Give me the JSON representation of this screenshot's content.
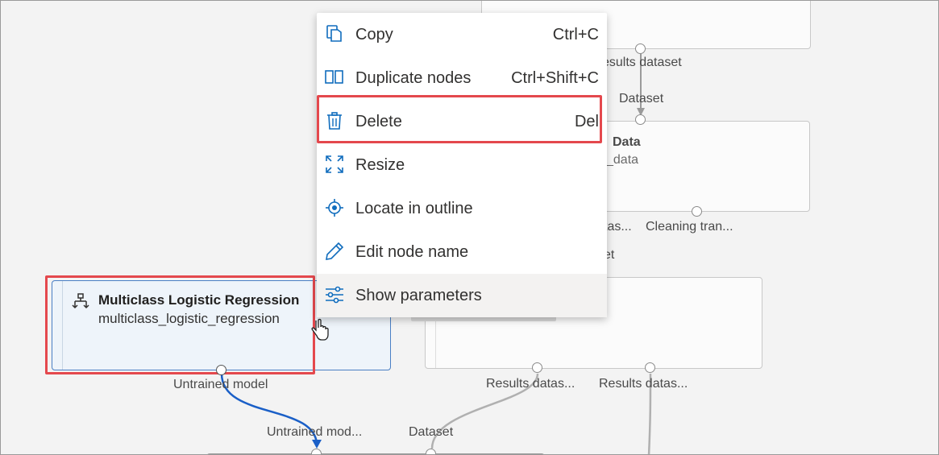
{
  "context_menu": {
    "items": [
      {
        "label": "Copy",
        "shortcut": "Ctrl+C",
        "icon": "copy-icon"
      },
      {
        "label": "Duplicate nodes",
        "shortcut": "Ctrl+Shift+C",
        "icon": "duplicate-icon"
      },
      {
        "label": "Delete",
        "shortcut": "Del",
        "icon": "trash-icon"
      },
      {
        "label": "Resize",
        "shortcut": "",
        "icon": "resize-icon"
      },
      {
        "label": "Locate in outline",
        "shortcut": "",
        "icon": "locate-icon"
      },
      {
        "label": "Edit node name",
        "shortcut": "",
        "icon": "pencil-icon"
      },
      {
        "label": "Show parameters",
        "shortcut": "",
        "icon": "sliders-icon"
      }
    ]
  },
  "selected_node": {
    "title": "Multiclass Logistic Regression",
    "subtitle": "multiclass_logistic_regression",
    "output_port": "Untrained model",
    "icon": "hierarchy-icon"
  },
  "canvas": {
    "top_right_node": {
      "output_port": "esults dataset"
    },
    "clean_data_node": {
      "input_port": "Dataset",
      "title": "Data",
      "subtitle": "_data",
      "output_ports": [
        "tas...",
        "Cleaning tran..."
      ]
    },
    "middle_node": {
      "input_port_partial": "et",
      "output_ports": [
        "Results datas...",
        "Results datas..."
      ]
    },
    "bottom_node": {
      "input_ports": [
        "Untrained mod...",
        "Dataset"
      ]
    }
  },
  "colors": {
    "accent": "#0f6cbd",
    "highlight": "#e4484d",
    "selected_edge": "#1a5fc7"
  }
}
